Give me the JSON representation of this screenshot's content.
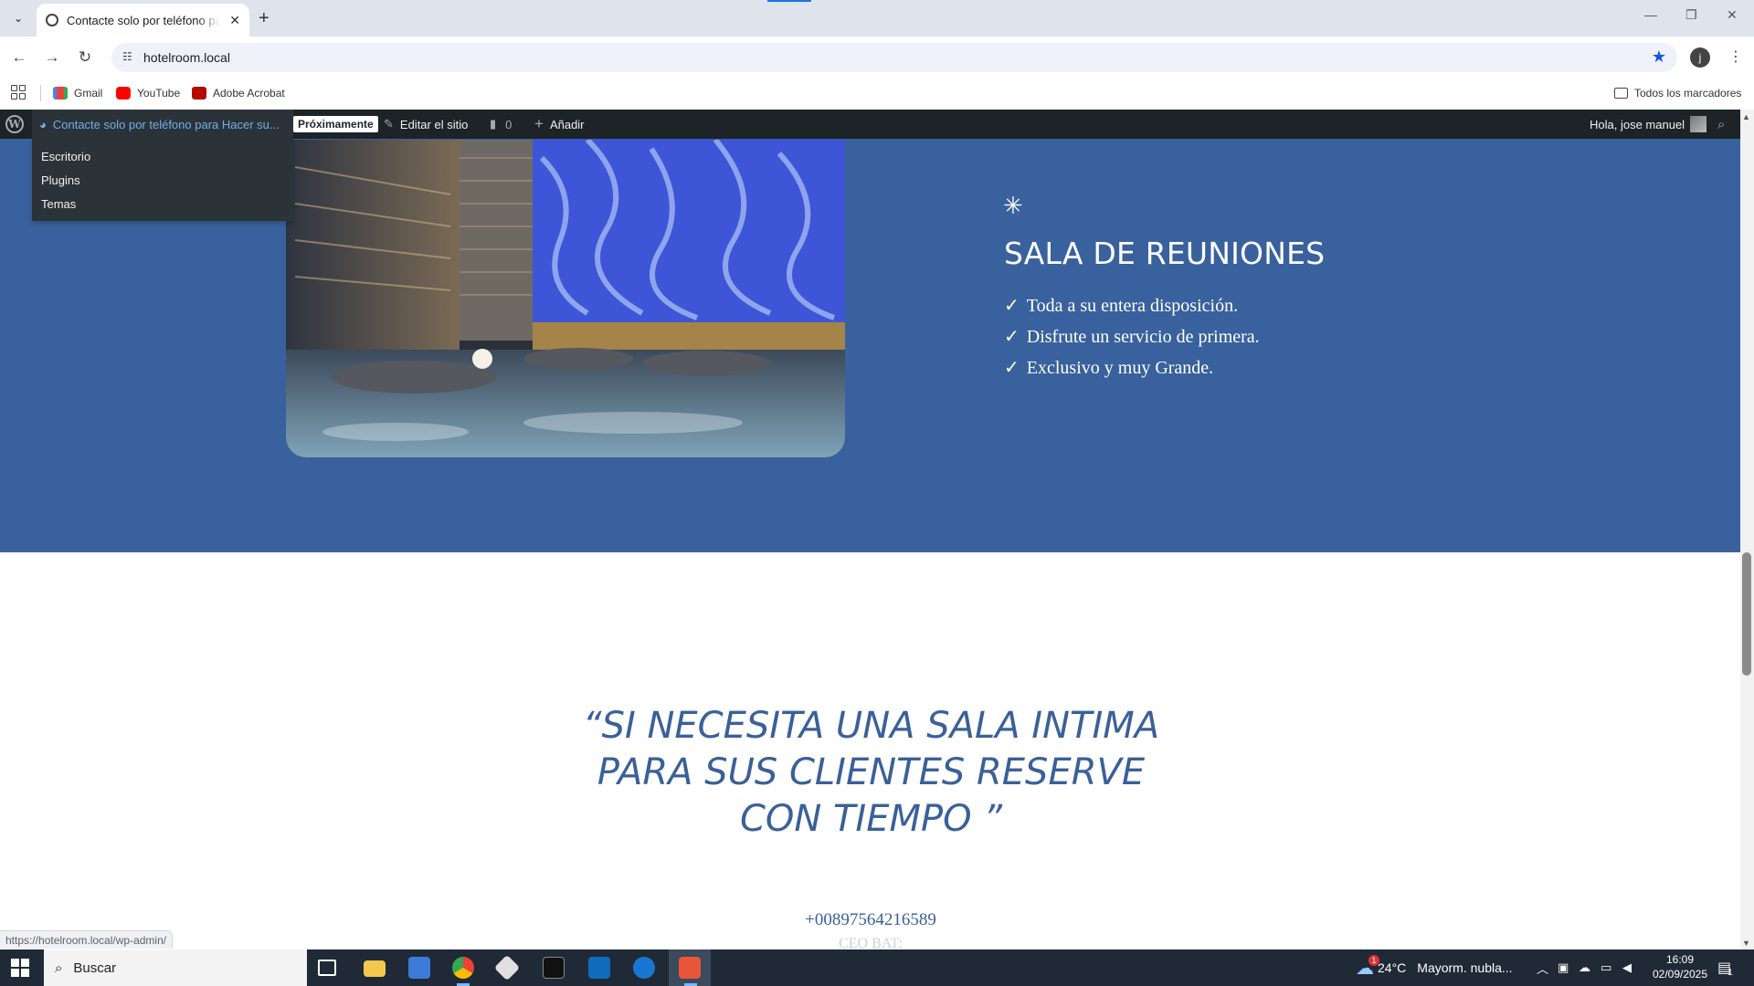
{
  "browser": {
    "tab_title": "Contacte solo por teléfono para Hacer su reserva",
    "url": "hotelroom.local",
    "profile_initial": "j",
    "bookmarks": [
      "Gmail",
      "YouTube",
      "Adobe Acrobat"
    ],
    "all_bookmarks": "Todos los marcadores"
  },
  "adminbar": {
    "site_name": "Contacte solo por teléfono para Hacer su...",
    "badge": "Próximamente",
    "edit_site": "Editar el sitio",
    "comments_count": "0",
    "add_new": "Añadir",
    "greeting": "Hola, jose manuel",
    "dropdown": [
      "Escritorio",
      "Plugins",
      "Temas"
    ]
  },
  "hero": {
    "title": "SALA DE REUNIONES",
    "checkmark": "✓",
    "features": [
      "Toda a su entera disposición.",
      "Disfrute un servicio de primera.",
      "Exclusivo y muy Grande."
    ]
  },
  "quote": {
    "line1": "“SI NECESITA UNA SALA INTIMA",
    "line2": "PARA SUS CLIENTES RESERVE",
    "line3": "CON TIEMPO ”"
  },
  "contact": {
    "phone": "+00897564216589",
    "role": "CEO BAT:"
  },
  "status_url": "https://hotelroom.local/wp-admin/",
  "taskbar": {
    "search_placeholder": "Buscar",
    "weather_temp": "24°C",
    "weather_desc": "Mayorm. nubla...",
    "time": "16:09",
    "date": "02/09/2025",
    "notification_count": "1",
    "weather_badge": "1"
  },
  "colors": {
    "hero_bg": "#39619d",
    "quote_text": "#3a6099",
    "adminbar_bg": "#1d2327"
  }
}
